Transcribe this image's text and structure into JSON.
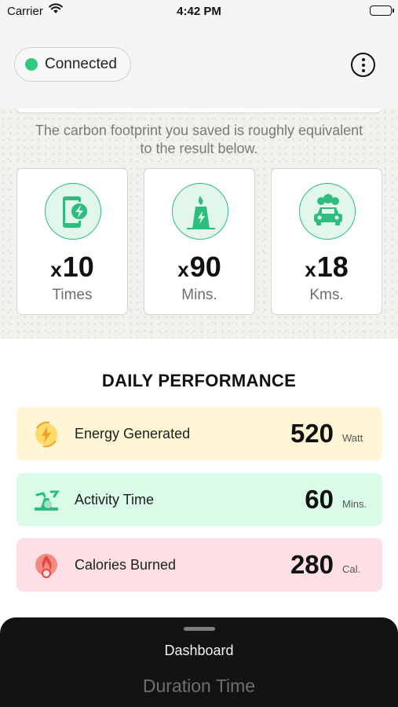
{
  "status_bar": {
    "carrier": "Carrier",
    "time": "4:42 PM"
  },
  "header": {
    "connection_status": "Connected",
    "status_color": "#2fca7d",
    "more_icon": "more-vertical-icon"
  },
  "carbon": {
    "note": "The carbon footprint you saved is roughly equivalent to the result below.",
    "accent_color": "#2fbd7f",
    "cards": [
      {
        "icon": "phone-charging-icon",
        "prefix": "x",
        "value": "10",
        "unit": "Times"
      },
      {
        "icon": "power-plant-icon",
        "prefix": "x",
        "value": "90",
        "unit": "Mins."
      },
      {
        "icon": "car-icon",
        "prefix": "x",
        "value": "18",
        "unit": "Kms."
      }
    ]
  },
  "performance": {
    "title": "DAILY PERFORMANCE",
    "rows": [
      {
        "icon": "energy-bolt-icon",
        "label": "Energy Generated",
        "value": "520",
        "unit": "Watt",
        "color": "#fff6d6"
      },
      {
        "icon": "exercise-bike-icon",
        "label": "Activity Time",
        "value": "60",
        "unit": "Mins.",
        "color": "#dafbe8"
      },
      {
        "icon": "calories-flame-icon",
        "label": "Calories Burned",
        "value": "280",
        "unit": "Cal.",
        "color": "#fde0e6"
      }
    ]
  },
  "bottom_sheet": {
    "items": [
      "Dashboard",
      "Duration Time"
    ]
  }
}
